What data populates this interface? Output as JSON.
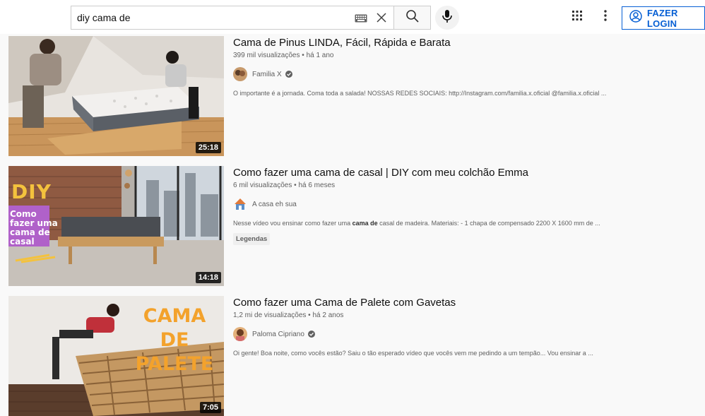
{
  "search": {
    "query": "diy cama de",
    "keyboard_icon": "keyboard-icon",
    "clear_icon": "close-icon",
    "search_icon": "search-icon",
    "mic_icon": "microphone-icon"
  },
  "header": {
    "apps_icon": "apps-grid-icon",
    "more_icon": "more-vert-icon",
    "login_label": "FAZER LOGIN",
    "login_icon": "account-circle-icon",
    "accent": "#065fd4"
  },
  "results": [
    {
      "title": "Cama de Pinus LINDA, Fácil, Rápida e Barata",
      "views": "399 mil visualizações",
      "age": "há 1 ano",
      "channel": "Familia X",
      "verified": true,
      "description": "O importante é a jornada. Coma toda a salada! NOSSAS REDES SOCIAIS: http://Instagram.com/familia.x.oficial @familia.x.oficial ...",
      "duration": "25:18"
    },
    {
      "title": "Como fazer uma cama de casal | DIY com meu colchão Emma",
      "views": "6 mil visualizações",
      "age": "há 6 meses",
      "channel": "A casa eh sua",
      "verified": false,
      "description_pre": "Nesse vídeo vou ensinar como fazer uma ",
      "description_bold": "cama de",
      "description_post": " casal de madeira. Materiais: - 1 chapa de compensado 2200 X 1600 mm de ...",
      "badge": "Legendas",
      "duration": "14:18",
      "thumb_text_diy": "DIY",
      "thumb_text_lines": [
        "Como",
        "fazer uma",
        "cama de",
        "casal"
      ]
    },
    {
      "title": "Como fazer uma Cama de Palete com Gavetas",
      "views": "1,2 mi de visualizações",
      "age": "há 2 anos",
      "channel": "Paloma Cipriano",
      "verified": true,
      "description": "Oi gente! Boa noite, como vocês estão? Saiu o tão esperado vídeo que vocês vem me pedindo a um tempão... Vou ensinar a ...",
      "duration": "7:05",
      "thumb_text_lines": [
        "CAMA DE",
        "PALETE"
      ]
    }
  ],
  "meta_separator": " • "
}
